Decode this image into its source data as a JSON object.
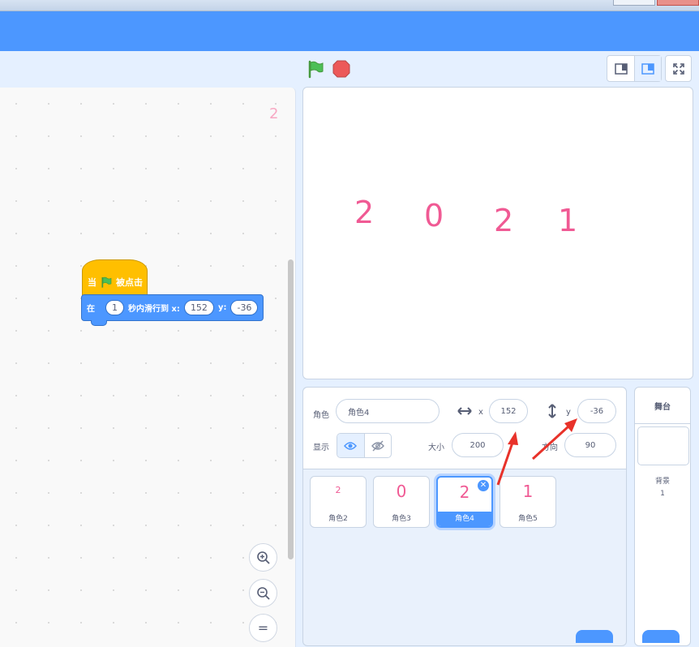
{
  "toolbar": {
    "green_flag_icon": "green-flag-icon",
    "stop_icon": "stop-icon"
  },
  "code": {
    "sprite_watermark": "2",
    "hat_block": {
      "prefix": "当",
      "suffix": "被点击"
    },
    "glide_block": {
      "prefix": "在",
      "secs": "1",
      "middle": "秒内滑行到 x:",
      "x": "152",
      "y_label": "y:",
      "y": "-36"
    },
    "zoom": {
      "in": "+",
      "out": "−",
      "reset": "="
    }
  },
  "stage": {
    "sprites": [
      "2",
      "0",
      "2",
      "1"
    ]
  },
  "sprite_info": {
    "sprite_label": "角色",
    "sprite_name": "角色4",
    "x_label": "x",
    "x_value": "152",
    "y_label": "y",
    "y_value": "-36",
    "show_label": "显示",
    "size_label": "大小",
    "size_value": "200",
    "direction_label": "方向",
    "direction_value": "90"
  },
  "sprite_list": [
    {
      "thumb": "2",
      "name": "角色2"
    },
    {
      "thumb": "0",
      "name": "角色3"
    },
    {
      "thumb": "2",
      "name": "角色4",
      "selected": true
    },
    {
      "thumb": "1",
      "name": "角色5"
    }
  ],
  "stage_pane": {
    "title": "舞台",
    "backdrops_label": "背景",
    "backdrops_count": "1"
  },
  "colors": {
    "accent": "#4c97ff",
    "event_block": "#ffbf00",
    "sprite_pink": "#f05a94",
    "annotation_red": "#e8322a"
  }
}
